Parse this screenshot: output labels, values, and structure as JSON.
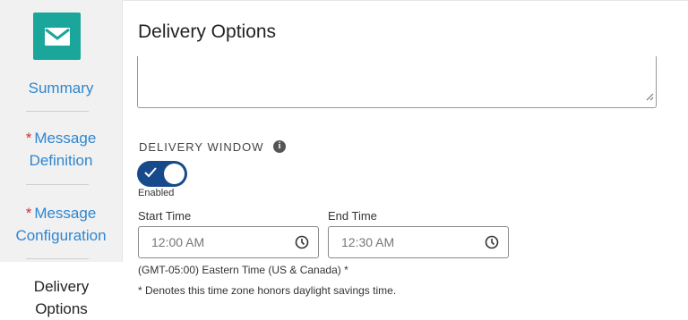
{
  "sidebar": {
    "items": [
      {
        "label": "Summary",
        "required": false
      },
      {
        "label": "Message Definition",
        "line1": "Message",
        "line2": "Definition",
        "required": true
      },
      {
        "label": "Message Configuration",
        "line1": "Message",
        "line2": "Configuration",
        "required": true
      }
    ],
    "active_line1": "Delivery",
    "active_line2": "Options",
    "required_mark": "*",
    "logo_icon": "envelope-icon",
    "accent_color": "#1aa69a",
    "link_color": "#2f86d0"
  },
  "main": {
    "title": "Delivery Options",
    "delivery_window": {
      "label": "DELIVERY WINDOW",
      "info_glyph": "i",
      "toggle_on": true,
      "toggle_caption": "Enabled",
      "toggle_color": "#174a8b"
    },
    "start_time": {
      "label": "Start Time",
      "value": "12:00 AM"
    },
    "end_time": {
      "label": "End Time",
      "value": "12:30 AM"
    },
    "timezone": "(GMT-05:00) Eastern Time (US & Canada) *",
    "dst_note": "* Denotes this time zone honors daylight savings time."
  }
}
